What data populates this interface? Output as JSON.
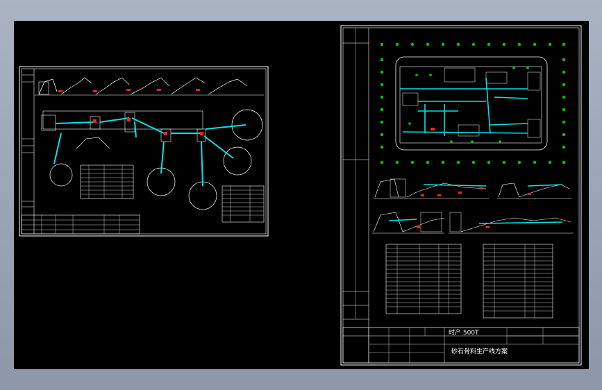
{
  "sheet_right": {
    "capacity": "时产 500T",
    "drawing_title": "砂石骨料生产线方案"
  },
  "colors": {
    "background": "#000000",
    "linework": "#ffffff",
    "conveyor": "#00e5e5",
    "trees": "#00cc00",
    "highlight": "#ff2020"
  }
}
